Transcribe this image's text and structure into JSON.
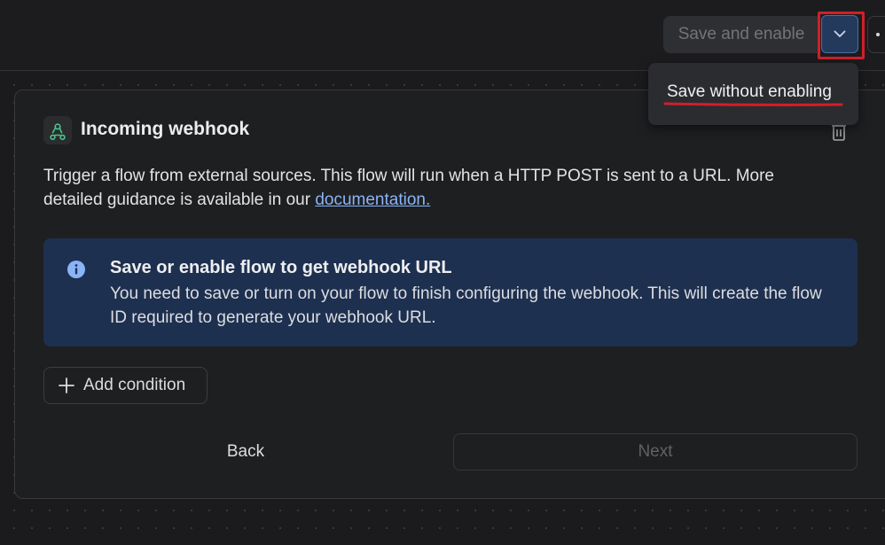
{
  "header": {
    "save_enable_label": "Save and enable",
    "dropdown_icon": "chevron-down-icon",
    "more_icon": "more-options-icon"
  },
  "dropdown_menu": {
    "items": [
      {
        "label": "Save without enabling"
      }
    ]
  },
  "trigger_card": {
    "icon": "webhook-icon",
    "title": "Incoming webhook",
    "delete_icon": "trash-icon",
    "description_text": "Trigger a flow from external sources. This flow will run when a HTTP POST is sent to a URL. More detailed guidance is available in our ",
    "documentation_link": "documentation.",
    "info": {
      "icon": "info-icon",
      "title": "Save or enable flow to get webhook URL",
      "body": "You need to save or turn on your flow to finish configuring the webhook. This will create the flow ID required to generate your webhook URL."
    },
    "add_condition_label": "Add condition",
    "back_label": "Back",
    "next_label": "Next"
  },
  "colors": {
    "background": "#1b1b1d",
    "card": "#1e1f21",
    "info_box": "#1e3050",
    "link": "#8ab4f8",
    "highlight": "#d11f2a",
    "accent": "#233a5c"
  }
}
